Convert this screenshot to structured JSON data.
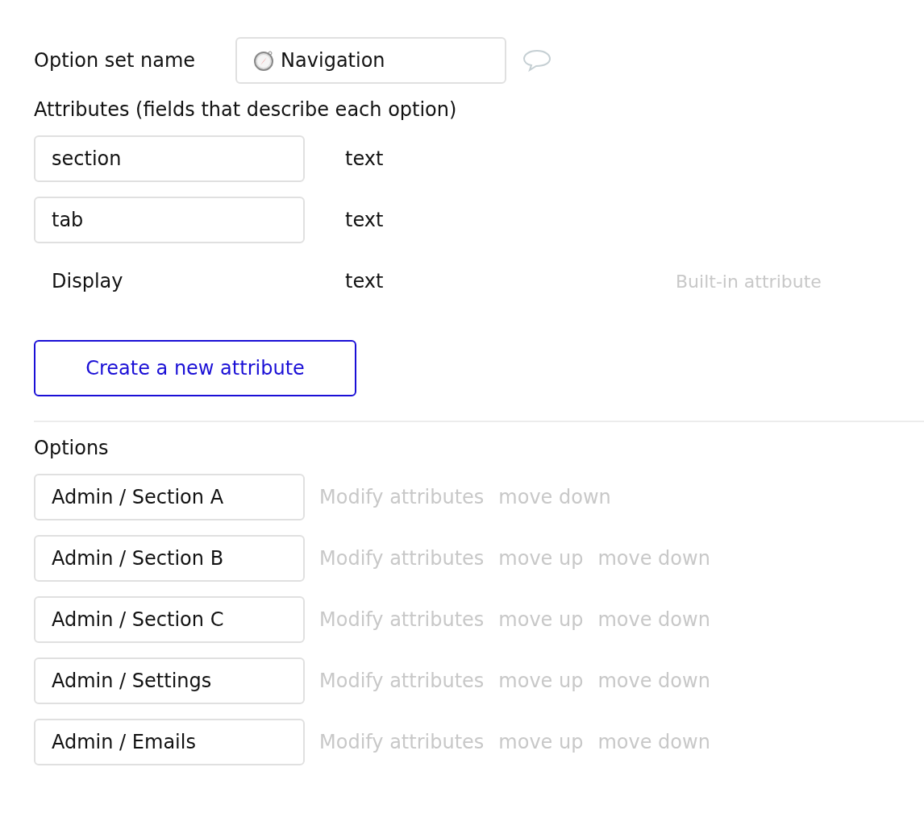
{
  "name_row": {
    "label": "Option set name",
    "value": "Navigation"
  },
  "attributes": {
    "heading": "Attributes (fields that describe each option)",
    "items": [
      {
        "kind": "field",
        "name": "section",
        "type": "text"
      },
      {
        "kind": "field",
        "name": "tab",
        "type": "text"
      },
      {
        "kind": "builtin",
        "name": "Display",
        "type": "text",
        "note": "Built-in attribute"
      }
    ],
    "create_button": "Create a new attribute"
  },
  "options": {
    "heading": "Options",
    "items": [
      {
        "name": "Admin / Section A",
        "actions": [
          "Modify attributes",
          "move down"
        ]
      },
      {
        "name": "Admin / Section B",
        "actions": [
          "Modify attributes",
          "move up",
          "move down"
        ]
      },
      {
        "name": "Admin / Section C",
        "actions": [
          "Modify attributes",
          "move up",
          "move down"
        ]
      },
      {
        "name": "Admin / Settings",
        "actions": [
          "Modify attributes",
          "move up",
          "move down"
        ]
      },
      {
        "name": "Admin / Emails",
        "actions": [
          "Modify attributes",
          "move up",
          "move down"
        ]
      }
    ]
  }
}
